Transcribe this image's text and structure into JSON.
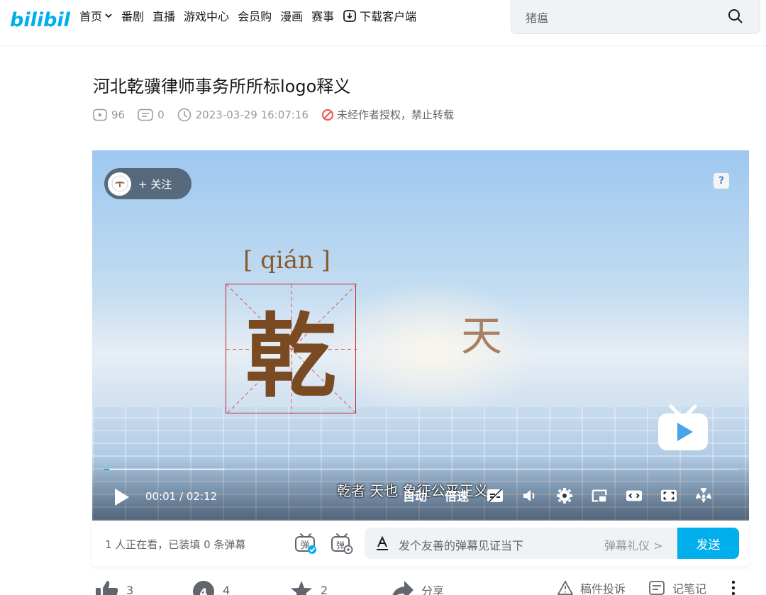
{
  "header": {
    "logo_text": "bilibili",
    "nav": [
      {
        "label": "首页",
        "has_chevron": true
      },
      {
        "label": "番剧"
      },
      {
        "label": "直播"
      },
      {
        "label": "游戏中心"
      },
      {
        "label": "会员购"
      },
      {
        "label": "漫画"
      },
      {
        "label": "赛事"
      },
      {
        "label": "下载客户端",
        "icon": "download-icon"
      }
    ],
    "search_value": "猪瘟"
  },
  "video": {
    "title": "河北乾骥律师事务所所标logo释义",
    "views": "96",
    "danmaku_count": "0",
    "datetime": "2023-03-29 16:07:16",
    "copyright_notice": "未经作者授权，禁止转载"
  },
  "player": {
    "follow_label": "+ 关注",
    "help_label": "?",
    "pinyin": "[ qián ]",
    "main_char": "乾",
    "side_char": "天",
    "subtitle": "乾者 天也 象征公平正义",
    "time_current": "00:01",
    "time_total": "02:12",
    "time_separator": "/",
    "progress": 0.008,
    "quality_label": "自动",
    "speed_label": "倍速",
    "subtitle_btn_label": "字幕"
  },
  "danmaku": {
    "viewer_text": "1 人正在看，已装填 0 条弹幕",
    "toggle_label": "弹",
    "input_placeholder": "发个友善的弹幕见证当下",
    "etiquette_label": "弹幕礼仪 >",
    "send_label": "发送"
  },
  "actions": {
    "like_count": "3",
    "coin_count": "4",
    "fav_count": "2",
    "share_label": "分享",
    "report_label": "稿件投诉",
    "notes_label": "记笔记"
  },
  "colors": {
    "brand_blue": "#00aeec",
    "text_primary": "#18191c",
    "text_secondary": "#9499a0",
    "warning_red": "#f25d59"
  }
}
